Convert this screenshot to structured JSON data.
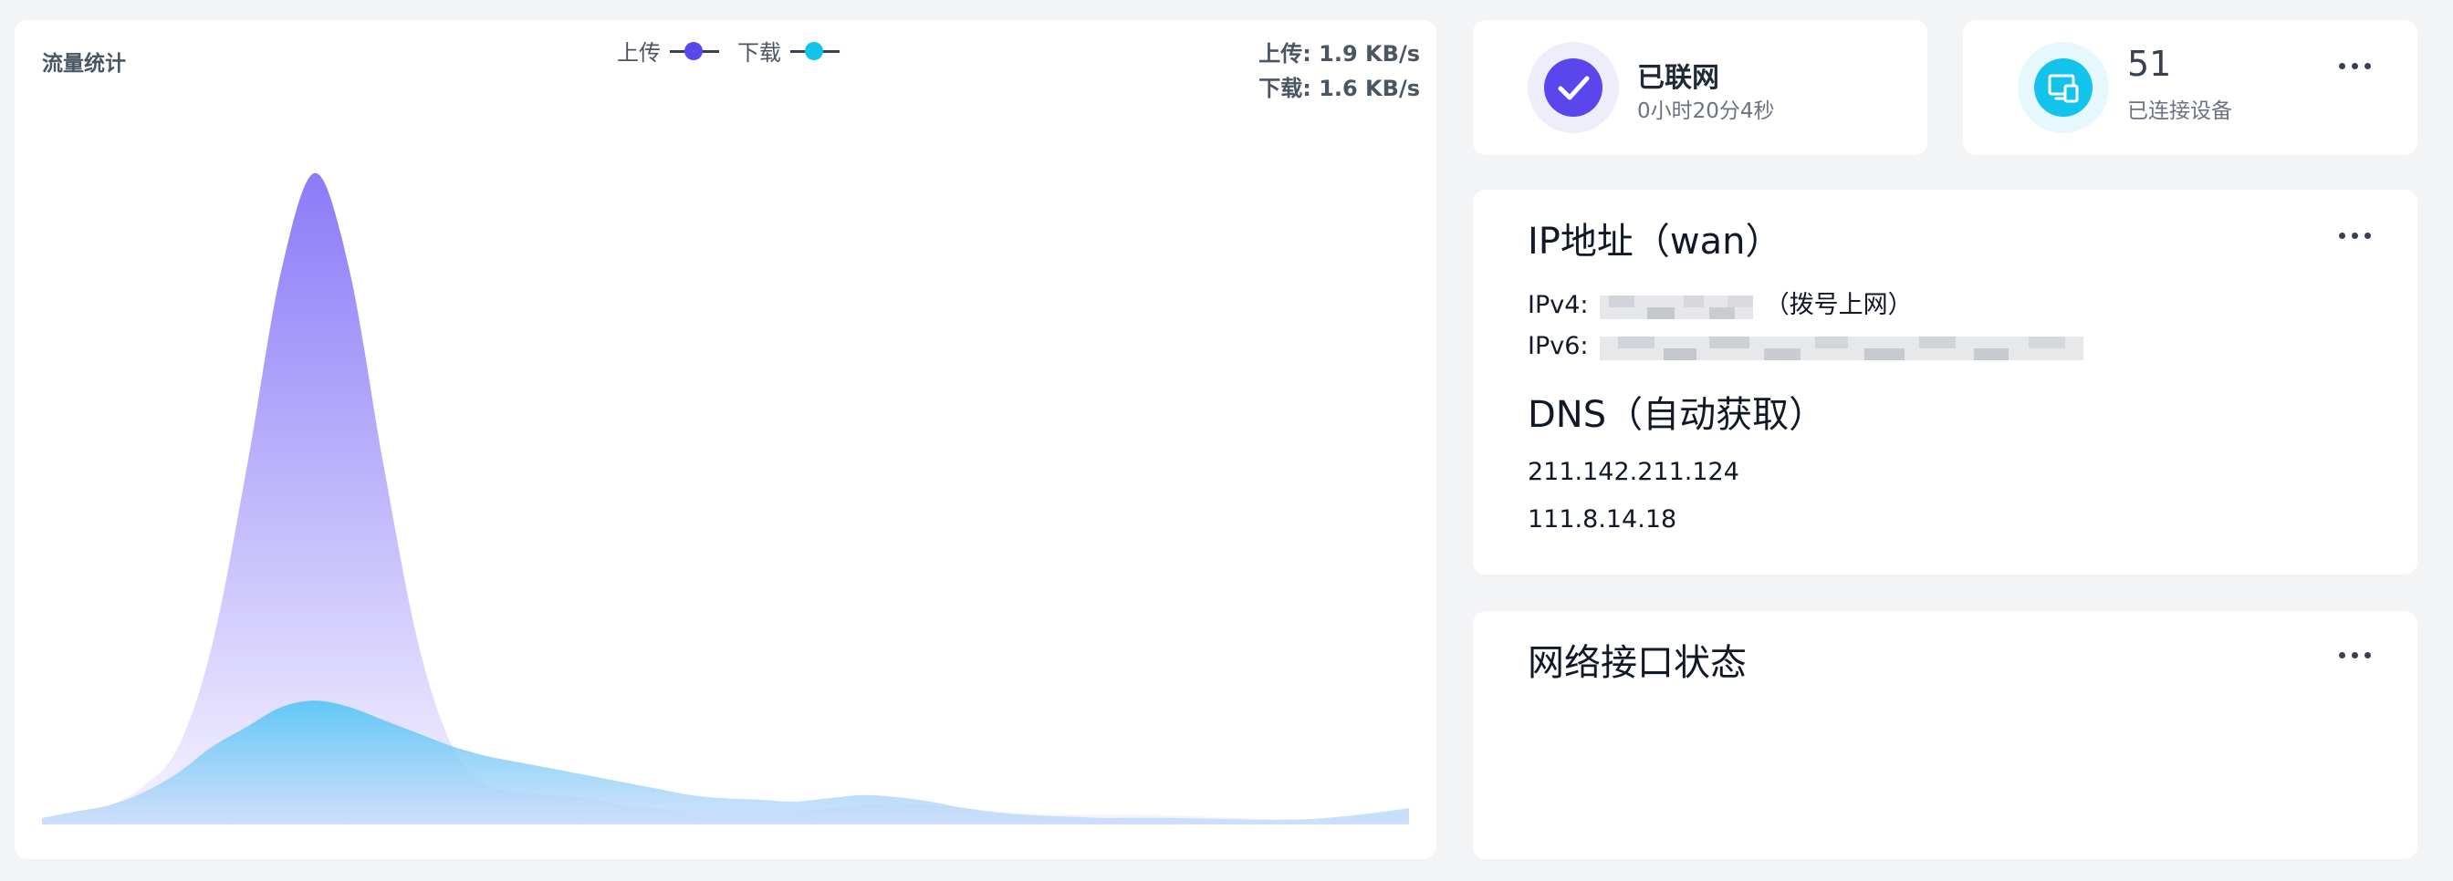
{
  "traffic": {
    "title": "流量统计",
    "legend": [
      {
        "label": "上传",
        "color": "#5b45ec"
      },
      {
        "label": "下载",
        "color": "#12c3ec"
      }
    ],
    "upload_rate": "上传: 1.9 KB/s",
    "download_rate": "下载: 1.6 KB/s"
  },
  "chart_data": {
    "type": "area",
    "x": [
      0,
      1,
      2,
      3,
      4,
      5,
      6,
      7,
      8,
      9,
      10,
      11,
      12,
      13,
      14,
      15,
      16,
      17,
      18,
      19,
      20,
      21,
      22,
      23,
      24,
      25,
      26,
      27,
      28,
      29,
      30,
      31,
      32,
      33,
      34,
      35,
      36,
      37,
      38,
      39,
      40
    ],
    "series": [
      {
        "name": "上传",
        "values": [
          0.01,
          0.02,
          0.03,
          0.06,
          0.12,
          0.28,
          0.55,
          0.85,
          1.0,
          0.85,
          0.55,
          0.28,
          0.12,
          0.06,
          0.05,
          0.045,
          0.04,
          0.03,
          0.025,
          0.02,
          0.02,
          0.02,
          0.02,
          0.025,
          0.03,
          0.032,
          0.03,
          0.025,
          0.02,
          0.016,
          0.015,
          0.015,
          0.015,
          0.014,
          0.012,
          0.01,
          0.008,
          0.008,
          0.01,
          0.015,
          0.02
        ],
        "color": "#8b7bf8"
      },
      {
        "name": "下载",
        "values": [
          0.01,
          0.02,
          0.03,
          0.05,
          0.08,
          0.12,
          0.15,
          0.18,
          0.19,
          0.18,
          0.16,
          0.14,
          0.12,
          0.105,
          0.095,
          0.085,
          0.075,
          0.065,
          0.055,
          0.045,
          0.04,
          0.038,
          0.035,
          0.04,
          0.045,
          0.042,
          0.035,
          0.025,
          0.018,
          0.014,
          0.012,
          0.01,
          0.01,
          0.01,
          0.009,
          0.008,
          0.007,
          0.008,
          0.012,
          0.018,
          0.025
        ],
        "color": "#5ee3f7"
      }
    ],
    "ylim": [
      0,
      1.05
    ]
  },
  "status": {
    "title": "已联网",
    "uptime": "0小时20分4秒",
    "icon": "check-icon",
    "color": "#5b45ec"
  },
  "devices": {
    "count": "51",
    "label": "已连接设备",
    "icon": "devices-icon",
    "color": "#12c3ec"
  },
  "ip": {
    "title": "IP地址（wan）",
    "ipv4_label": "IPv4:",
    "ipv4_suffix": "（拨号上网）",
    "ipv6_label": "IPv6:",
    "dns_title": "DNS（自动获取）",
    "dns": [
      "211.142.211.124",
      "111.8.14.18"
    ]
  },
  "interfaces": {
    "title": "网络接口状态"
  }
}
